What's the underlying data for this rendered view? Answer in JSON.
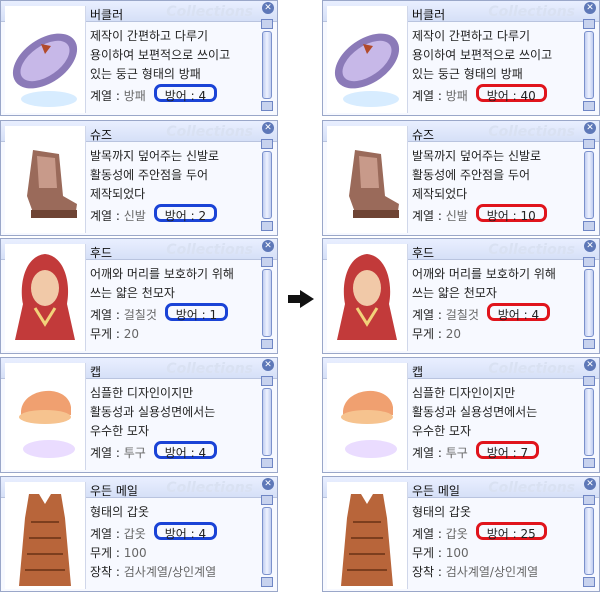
{
  "watermark": "Collections",
  "arrow": "➡",
  "before": [
    {
      "name": "버클러",
      "desc": [
        "제작이 간편하고 다루기",
        "용이하여 보편적으로 쓰이고",
        "있는 둥근 형태의 방패"
      ],
      "stats": [
        {
          "k": "계열",
          "v": "방패"
        }
      ],
      "defense": "방어 : 4",
      "extra": []
    },
    {
      "name": "슈즈",
      "desc": [
        "발목까지 덮어주는 신발로",
        "활동성에 주안점을 두어",
        "제작되었다"
      ],
      "stats": [
        {
          "k": "계열",
          "v": "신발"
        }
      ],
      "defense": "방어 : 2",
      "extra": []
    },
    {
      "name": "후드",
      "desc": [
        "어깨와 머리를 보호하기 위해",
        "쓰는 얇은 천모자"
      ],
      "stats": [
        {
          "k": "계열",
          "v": "걸칠것"
        }
      ],
      "defense": "방어 : 1",
      "extra": [
        {
          "k": "무게",
          "v": "20"
        }
      ]
    },
    {
      "name": "캡",
      "desc": [
        "심플한 디자인이지만",
        "활동성과 실용성면에서는",
        "우수한 모자"
      ],
      "stats": [
        {
          "k": "계열",
          "v": "투구"
        }
      ],
      "defense": "방어 : 4",
      "extra": []
    },
    {
      "name": "우든 메일",
      "desc": [
        "형태의 갑옷"
      ],
      "stats": [
        {
          "k": "계열",
          "v": "갑옷"
        }
      ],
      "defense": "방어 : 4",
      "extra": [
        {
          "k": "무게",
          "v": "100"
        },
        {
          "k": "장착",
          "v": "검사계열/상인계열"
        }
      ]
    }
  ],
  "after": [
    {
      "name": "버클러",
      "desc": [
        "제작이 간편하고 다루기",
        "용이하여 보편적으로 쓰이고",
        "있는 둥근 형태의 방패"
      ],
      "stats": [
        {
          "k": "계열",
          "v": "방패"
        }
      ],
      "defense": "방어 : 40",
      "extra": []
    },
    {
      "name": "슈즈",
      "desc": [
        "발목까지 덮어주는 신발로",
        "활동성에 주안점을 두어",
        "제작되었다"
      ],
      "stats": [
        {
          "k": "계열",
          "v": "신발"
        }
      ],
      "defense": "방어 : 10",
      "extra": []
    },
    {
      "name": "후드",
      "desc": [
        "어깨와 머리를 보호하기 위해",
        "쓰는 얇은 천모자"
      ],
      "stats": [
        {
          "k": "계열",
          "v": "걸칠것"
        }
      ],
      "defense": "방어 : 4",
      "extra": [
        {
          "k": "무게",
          "v": "20"
        }
      ]
    },
    {
      "name": "캡",
      "desc": [
        "심플한 디자인이지만",
        "활동성과 실용성면에서는",
        "우수한 모자"
      ],
      "stats": [
        {
          "k": "계열",
          "v": "투구"
        }
      ],
      "defense": "방어 : 7",
      "extra": []
    },
    {
      "name": "우든 메일",
      "desc": [
        "형태의 갑옷"
      ],
      "stats": [
        {
          "k": "계열",
          "v": "갑옷"
        }
      ],
      "defense": "방어 : 25",
      "extra": [
        {
          "k": "무게",
          "v": "100"
        },
        {
          "k": "장착",
          "v": "검사계열/상인계열"
        }
      ]
    }
  ],
  "colors": {
    "before_highlight": "#1a43d6",
    "after_highlight": "#e0141c"
  }
}
